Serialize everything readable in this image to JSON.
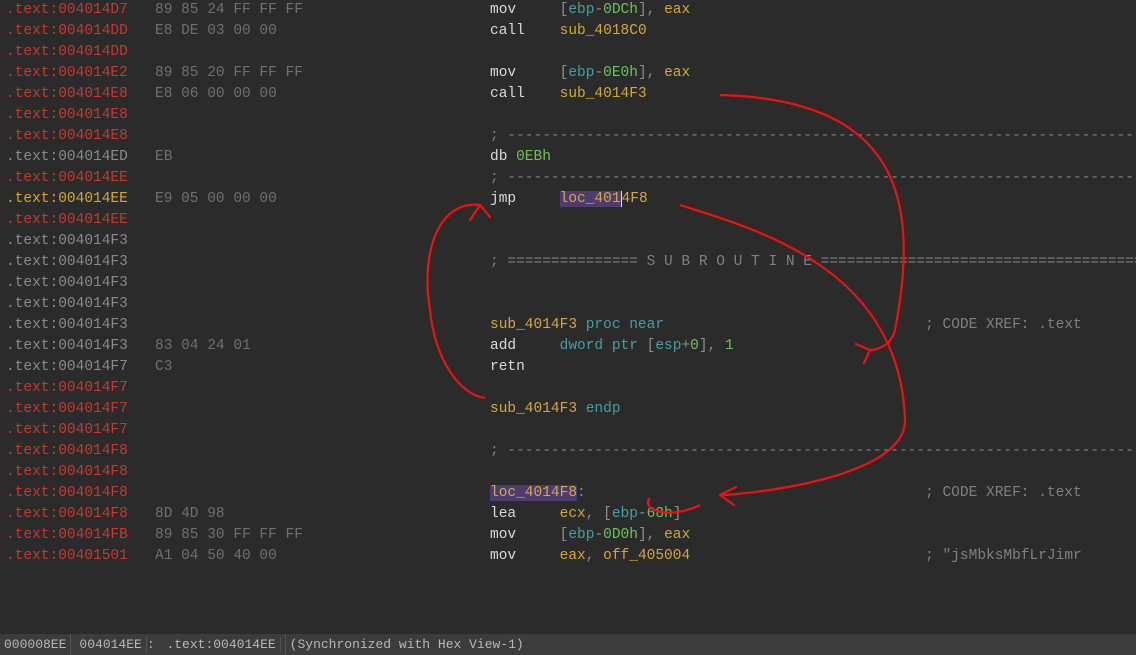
{
  "status": {
    "offset": "000008EE",
    "addr": "004014EE",
    "seg": ".text:004014EE",
    "sync": "(Synchronized with Hex View-1)"
  },
  "lines": [
    {
      "addr": ".text:004014D7",
      "ac": "addr-red",
      "bytes": "89 85 24 FF FF FF",
      "code": [
        [
          "mnem",
          "mov     "
        ],
        [
          "grey",
          "["
        ],
        [
          "mreg",
          "ebp"
        ],
        [
          "grey",
          "-"
        ],
        [
          "num",
          "0DCh"
        ],
        [
          "grey",
          "], "
        ],
        [
          "reg",
          "eax"
        ]
      ]
    },
    {
      "addr": ".text:004014DD",
      "ac": "addr-red",
      "bytes": "E8 DE 03 00 00",
      "code": [
        [
          "mnem",
          "call    "
        ],
        [
          "sub",
          "sub_4018C0"
        ]
      ]
    },
    {
      "addr": ".text:004014DD",
      "ac": "addr-red",
      "bytes": "",
      "code": []
    },
    {
      "addr": ".text:004014E2",
      "ac": "addr-red",
      "bytes": "89 85 20 FF FF FF",
      "code": [
        [
          "mnem",
          "mov     "
        ],
        [
          "grey",
          "["
        ],
        [
          "mreg",
          "ebp"
        ],
        [
          "grey",
          "-"
        ],
        [
          "num",
          "0E0h"
        ],
        [
          "grey",
          "], "
        ],
        [
          "reg",
          "eax"
        ]
      ]
    },
    {
      "addr": ".text:004014E8",
      "ac": "addr-red",
      "bytes": "E8 06 00 00 00",
      "code": [
        [
          "mnem",
          "call    "
        ],
        [
          "sub",
          "sub_4014F3"
        ]
      ]
    },
    {
      "addr": ".text:004014E8",
      "ac": "addr-red",
      "bytes": "",
      "code": []
    },
    {
      "addr": ".text:004014E8",
      "ac": "addr-red",
      "bytes": "",
      "code": [
        [
          "comm",
          "; ---------------------------------------------------------------------------"
        ]
      ]
    },
    {
      "addr": ".text:004014ED",
      "ac": "addr-grey",
      "bytes": "EB",
      "code": [
        [
          "mnem",
          "db "
        ],
        [
          "num",
          "0EBh"
        ]
      ]
    },
    {
      "addr": ".text:004014EE",
      "ac": "addr-red",
      "bytes": "",
      "code": [
        [
          "comm",
          "; ---------------------------------------------------------------------------"
        ]
      ]
    },
    {
      "addr": ".text:004014EE",
      "ac": "addr-hl",
      "bytes": "E9 05 00 00 00",
      "code": [
        [
          "mnem",
          "jmp     "
        ],
        [
          "loc hlbg",
          "loc_401"
        ],
        [
          "loc cursor",
          "4F8"
        ]
      ]
    },
    {
      "addr": ".text:004014EE",
      "ac": "addr-red",
      "bytes": "",
      "code": []
    },
    {
      "addr": ".text:004014F3",
      "ac": "addr-grey",
      "bytes": "",
      "code": []
    },
    {
      "addr": ".text:004014F3",
      "ac": "addr-grey",
      "bytes": "",
      "code": [
        [
          "comm",
          "; =============== S U B R O U T I N E ======================================="
        ]
      ]
    },
    {
      "addr": ".text:004014F3",
      "ac": "addr-grey",
      "bytes": "",
      "code": []
    },
    {
      "addr": ".text:004014F3",
      "ac": "addr-grey",
      "bytes": "",
      "code": []
    },
    {
      "addr": ".text:004014F3",
      "ac": "addr-grey",
      "bytes": "",
      "code": [
        [
          "fn",
          "sub_4014F3 "
        ],
        [
          "kw",
          "proc near"
        ]
      ],
      "xref": "; CODE XREF: .text"
    },
    {
      "addr": ".text:004014F3",
      "ac": "addr-grey",
      "bytes": "83 04 24 01",
      "code": [
        [
          "mnem",
          "add     "
        ],
        [
          "kw",
          "dword ptr "
        ],
        [
          "grey",
          "["
        ],
        [
          "mreg",
          "esp"
        ],
        [
          "grey",
          "+"
        ],
        [
          "num",
          "0"
        ],
        [
          "grey",
          "], "
        ],
        [
          "num",
          "1"
        ]
      ]
    },
    {
      "addr": ".text:004014F7",
      "ac": "addr-grey",
      "bytes": "C3",
      "code": [
        [
          "mnem",
          "retn"
        ]
      ]
    },
    {
      "addr": ".text:004014F7",
      "ac": "addr-red",
      "bytes": "",
      "code": []
    },
    {
      "addr": ".text:004014F7",
      "ac": "addr-red",
      "bytes": "",
      "code": [
        [
          "fn",
          "sub_4014F3 "
        ],
        [
          "kw",
          "endp"
        ]
      ]
    },
    {
      "addr": ".text:004014F7",
      "ac": "addr-red",
      "bytes": "",
      "code": []
    },
    {
      "addr": ".text:004014F8",
      "ac": "addr-red",
      "bytes": "",
      "code": [
        [
          "comm",
          "; ---------------------------------------------------------------------------"
        ]
      ]
    },
    {
      "addr": ".text:004014F8",
      "ac": "addr-red",
      "bytes": "",
      "code": []
    },
    {
      "addr": ".text:004014F8",
      "ac": "addr-red",
      "bytes": "",
      "code": [
        [
          "loc hlbg",
          "loc_4014F8"
        ],
        [
          "grey",
          ":"
        ]
      ],
      "xref": "; CODE XREF: .text"
    },
    {
      "addr": ".text:004014F8",
      "ac": "addr-red",
      "bytes": "8D 4D 98",
      "code": [
        [
          "mnem",
          "lea     "
        ],
        [
          "reg",
          "ecx"
        ],
        [
          "grey",
          ", ["
        ],
        [
          "mreg",
          "ebp"
        ],
        [
          "grey",
          "-"
        ],
        [
          "num",
          "68h"
        ],
        [
          "grey",
          "]"
        ]
      ]
    },
    {
      "addr": ".text:004014FB",
      "ac": "addr-red",
      "bytes": "89 85 30 FF FF FF",
      "code": [
        [
          "mnem",
          "mov     "
        ],
        [
          "grey",
          "["
        ],
        [
          "mreg",
          "ebp"
        ],
        [
          "grey",
          "-"
        ],
        [
          "num",
          "0D0h"
        ],
        [
          "grey",
          "], "
        ],
        [
          "reg",
          "eax"
        ]
      ]
    },
    {
      "addr": ".text:00401501",
      "ac": "addr-red",
      "bytes": "A1 04 50 40 00",
      "code": [
        [
          "mnem",
          "mov     "
        ],
        [
          "reg",
          "eax"
        ],
        [
          "grey",
          ", "
        ],
        [
          "sub",
          "off_405004"
        ]
      ],
      "xref": "; \"jsMbksMbfLrJimr"
    }
  ]
}
